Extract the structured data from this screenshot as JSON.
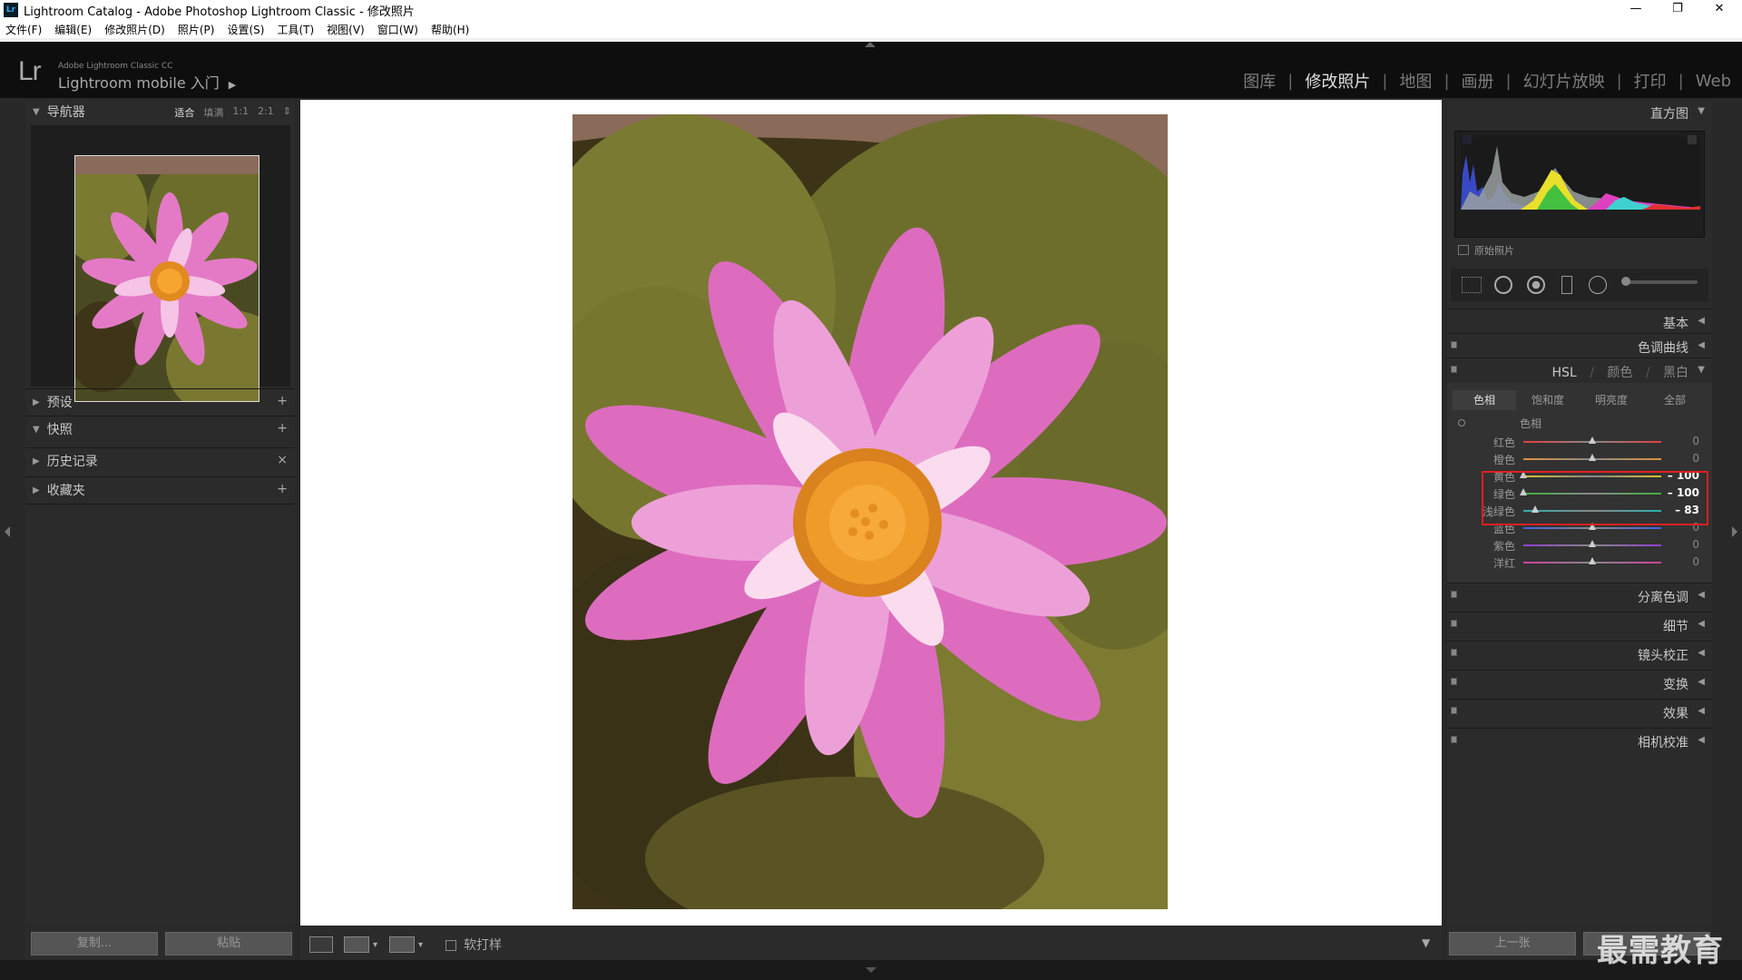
{
  "window": {
    "title": "Lightroom Catalog - Adobe Photoshop Lightroom Classic - 修改照片",
    "icon": "Lr",
    "minimize": "—",
    "maximize": "❐",
    "close": "✕"
  },
  "menu": [
    "文件(F)",
    "编辑(E)",
    "修改照片(D)",
    "照片(P)",
    "设置(S)",
    "工具(T)",
    "视图(V)",
    "窗口(W)",
    "帮助(H)"
  ],
  "identity": {
    "logo": "Lr",
    "line1": "Adobe Lightroom Classic CC",
    "line2": "Lightroom mobile 入门"
  },
  "modules": {
    "items": [
      "图库",
      "修改照片",
      "地图",
      "画册",
      "幻灯片放映",
      "打印",
      "Web"
    ],
    "active": "修改照片"
  },
  "navigator": {
    "title": "导航器",
    "zoom_options": [
      "适合",
      "填满",
      "1:1",
      "2:1"
    ],
    "zoom_selected": "适合"
  },
  "left_sections": [
    {
      "label": "预设",
      "action": "+",
      "open": false
    },
    {
      "label": "快照",
      "action": "+",
      "open": true
    },
    {
      "label": "历史记录",
      "action": "×",
      "open": false
    },
    {
      "label": "收藏夹",
      "action": "+",
      "open": false
    }
  ],
  "left_buttons": {
    "copy": "复制...",
    "paste": "粘贴"
  },
  "toolbar": {
    "softproof_label": "软打样"
  },
  "right_panel": {
    "histogram_title": "直方图",
    "original_photo": "原始照片",
    "sections": {
      "basic": "基本",
      "tone_curve": "色调曲线",
      "hsl_title_hsl": "HSL",
      "hsl_title_color": "颜色",
      "hsl_title_bw": "黑白",
      "split_toning": "分离色调",
      "detail": "细节",
      "lens": "镜头校正",
      "transform": "变换",
      "effects": "效果",
      "calibration": "相机校准"
    },
    "hsl_tabs": [
      "色相",
      "饱和度",
      "明亮度",
      "全部"
    ],
    "hsl_tab_selected": "色相",
    "hsl_group_label": "色相",
    "hue_sliders": [
      {
        "name": "红色",
        "value": "0",
        "color": "#e04040"
      },
      {
        "name": "橙色",
        "value": "0",
        "color": "#e09040"
      },
      {
        "name": "黄色",
        "value": "– 100",
        "color": "#d8c030"
      },
      {
        "name": "绿色",
        "value": "– 100",
        "color": "#40b040"
      },
      {
        "name": "浅绿色",
        "value": "– 83",
        "color": "#30b0b0"
      },
      {
        "name": "蓝色",
        "value": "0",
        "color": "#4060e0"
      },
      {
        "name": "紫色",
        "value": "0",
        "color": "#9040d0"
      },
      {
        "name": "洋红",
        "value": "0",
        "color": "#d040a0"
      }
    ],
    "hue_values_numeric": [
      0,
      0,
      -100,
      -100,
      -83,
      0,
      0,
      0
    ]
  },
  "right_buttons": {
    "previous": "上一张"
  },
  "watermark": "最需教育"
}
